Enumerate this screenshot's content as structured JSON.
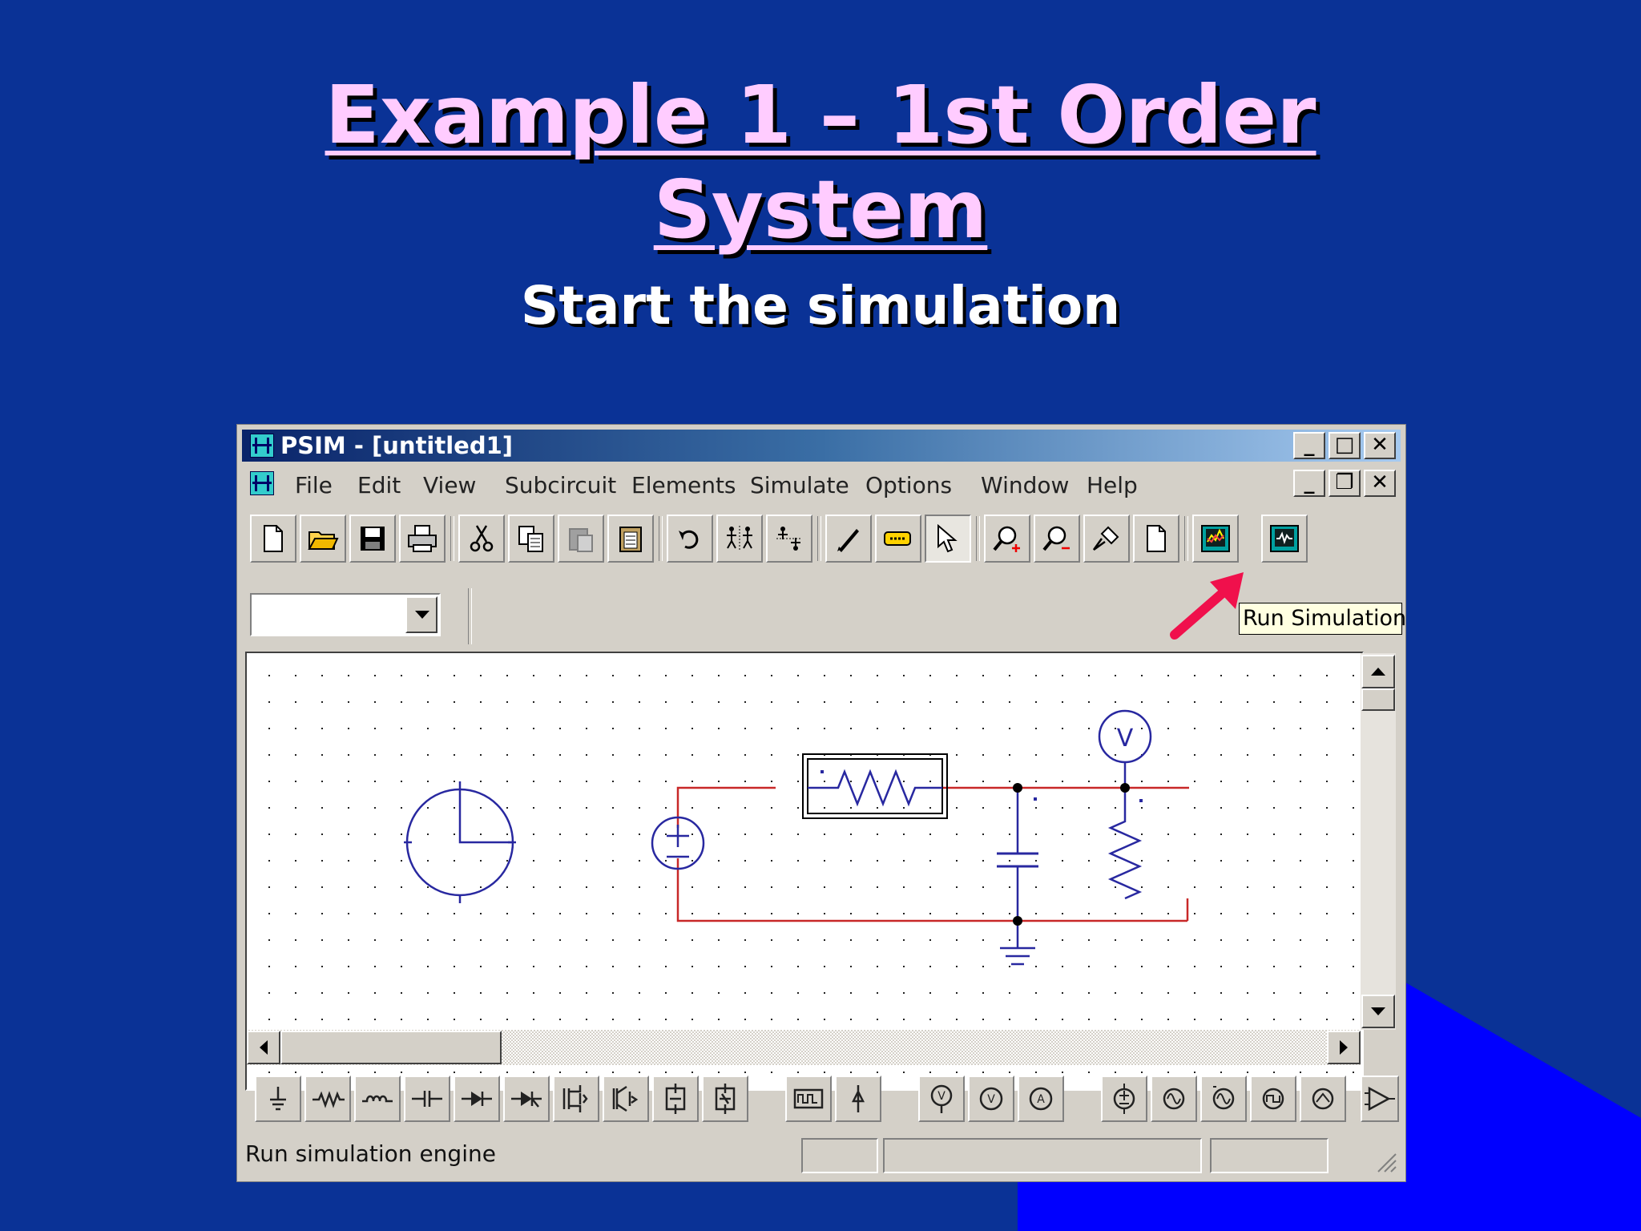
{
  "slide": {
    "title_line1": "Example 1 – 1st Order",
    "title_line2": "System",
    "subtitle": "Start the simulation",
    "background_color": "#0a3296",
    "accent_color": "#0000ff",
    "title_color": "#ffccff"
  },
  "window": {
    "title": "PSIM - [untitled1]",
    "menu": [
      "File",
      "Edit",
      "View",
      "Subcircuit",
      "Elements",
      "Simulate",
      "Options",
      "Window",
      "Help"
    ],
    "toolbar_icons": [
      "new-file-icon",
      "open-folder-icon",
      "save-disk-icon",
      "print-icon",
      "cut-scissors-icon",
      "copy-icon",
      "paste-disabled-icon",
      "clipboard-icon",
      "rotate-icon",
      "flip-lr-icon",
      "flip-tb-icon",
      "wire-pencil-icon",
      "label-icon",
      "select-arrow-icon",
      "zoom-in-icon",
      "zoom-out-icon",
      "pan-icon",
      "fit-page-icon",
      "run-simulation-icon",
      "simview-icon"
    ],
    "tooltip": "Run Simulation",
    "combo_value": "",
    "status_text": "Run simulation engine",
    "bottom_toolbar_icons": [
      "ground-icon",
      "resistor-icon",
      "inductor-icon",
      "capacitor-icon",
      "diode-icon",
      "thyristor-icon",
      "mosfet-icon",
      "igbt-icon",
      "switch-icon",
      "switch2-icon",
      "gating-block-icon",
      "dc-source-icon",
      "voltage-probe-icon",
      "voltage-meter-icon",
      "ammeter-icon",
      "dc-voltage-source-icon",
      "sine-source-icon",
      "sine-source-2-icon",
      "square-source-icon",
      "triangle-source-icon",
      "comparator-icon"
    ],
    "circuit_labels": {
      "voltage_probe": "V"
    }
  }
}
